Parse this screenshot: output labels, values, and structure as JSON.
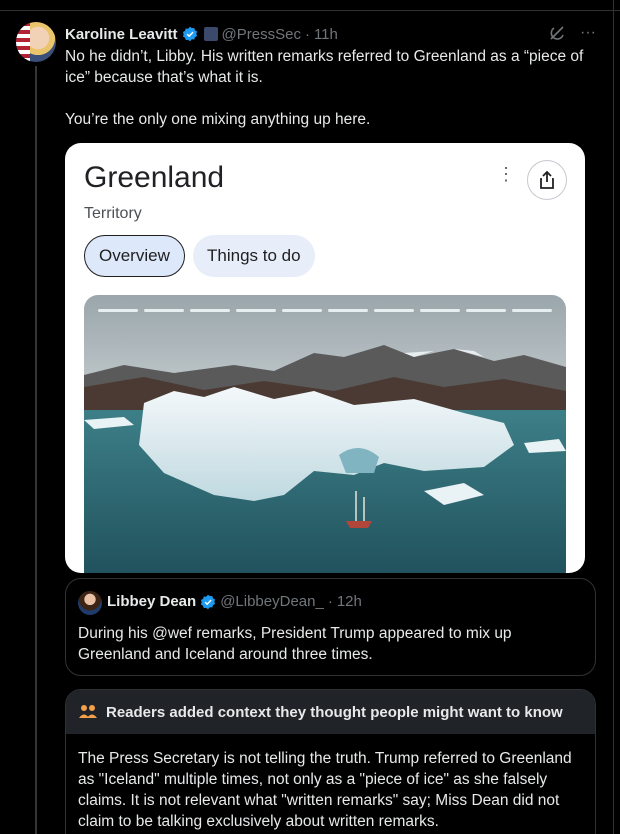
{
  "tweet": {
    "author_name": "Karoline Leavitt",
    "handle": "@PressSec",
    "separator": "·",
    "time": "11h",
    "text_line1": "No he didn’t, Libby. His written remarks referred to Greenland as a “piece of ice” because that’s what it is.",
    "text_line2": "You’re the only one mixing anything up here.",
    "more_icon": "···"
  },
  "media": {
    "title": "Greenland",
    "subtitle": "Territory",
    "kebab": "⋮",
    "chips": [
      "Overview",
      "Things to do"
    ]
  },
  "quoted_tweet": {
    "author_name": "Libbey Dean",
    "handle": "@LibbeyDean_",
    "separator": "·",
    "time": "12h",
    "text": "During his @wef remarks, President Trump appeared to mix up Greenland and Iceland around three times."
  },
  "community_note": {
    "title": "Readers added context they thought people might want to know",
    "body": "The Press Secretary is not telling the truth. Trump referred to Greenland as \"Iceland\" multiple times, not only as a \"piece of ice\" as she falsely claims. It is not relevant what \"written remarks\" say; Miss Dean did not claim to be talking exclusively about written remarks."
  },
  "colors": {
    "background": "#000000",
    "text": "#e7e9ea",
    "muted": "#71767b",
    "verified": "#1d9bf0",
    "note_icon": "#f4a14a"
  },
  "icons": [
    "verified-badge-icon",
    "gov-badge-icon",
    "grok-icon",
    "more-icon",
    "share-icon",
    "people-icon"
  ]
}
